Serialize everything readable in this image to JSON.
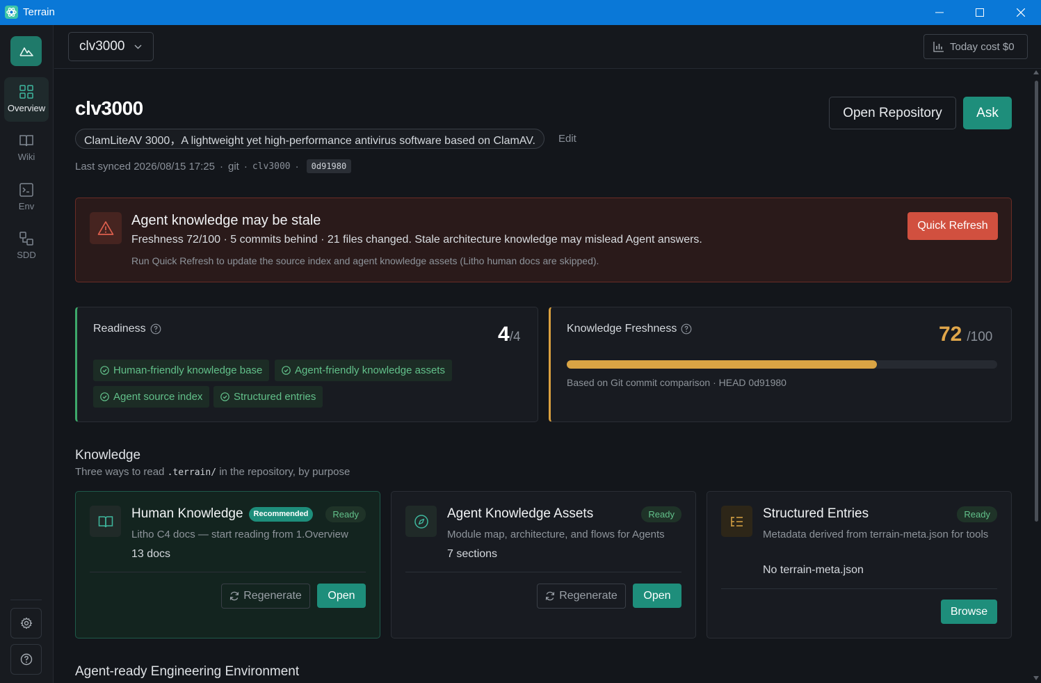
{
  "window": {
    "title": "Terrain"
  },
  "sidebar": {
    "items": [
      {
        "label": "Overview",
        "icon": "grid-icon"
      },
      {
        "label": "Wiki",
        "icon": "book-icon"
      },
      {
        "label": "Env",
        "icon": "terminal-icon"
      },
      {
        "label": "SDD",
        "icon": "shapes-icon"
      }
    ]
  },
  "topbar": {
    "repo": "clv3000",
    "cost": "Today cost $0"
  },
  "header": {
    "title": "clv3000",
    "description": "ClamLiteAV 3000，A lightweight yet high-performance antivirus software based on ClamAV.",
    "edit": "Edit",
    "synced": "Last synced 2026/08/15 17:25",
    "vcs": "git",
    "branch": "clv3000",
    "commit": "0d91980",
    "open_repo": "Open Repository",
    "ask": "Ask"
  },
  "alert": {
    "title": "Agent knowledge may be stale",
    "body": "Freshness 72/100 · 5 commits behind · 21 files changed. Stale architecture knowledge may mislead Agent answers.",
    "hint": "Run Quick Refresh to update the source index and agent knowledge assets (Litho human docs are skipped).",
    "action": "Quick Refresh",
    "color": "#d1503f"
  },
  "readiness": {
    "label": "Readiness",
    "value": "4",
    "total": "/4",
    "chips": [
      "Human-friendly knowledge base",
      "Agent-friendly knowledge assets",
      "Agent source index",
      "Structured entries"
    ]
  },
  "freshness": {
    "label": "Knowledge Freshness",
    "value": "72",
    "total": "/100",
    "progress": 0.72,
    "note": "Based on Git commit comparison · HEAD 0d91980",
    "color": "#d9a444"
  },
  "knowledge": {
    "title": "Knowledge",
    "subtitle_pre": "Three ways to read",
    "subtitle_code": ".terrain/",
    "subtitle_post": "in the repository, by purpose",
    "cards": [
      {
        "title": "Human Knowledge",
        "badge": "Recommended",
        "status": "Ready",
        "desc": "Litho C4 docs — start reading from 1.Overview",
        "count": "13 docs",
        "regen": "Regenerate",
        "open": "Open"
      },
      {
        "title": "Agent Knowledge Assets",
        "status": "Ready",
        "desc": "Module map, architecture, and flows for Agents",
        "count": "7 sections",
        "regen": "Regenerate",
        "open": "Open"
      },
      {
        "title": "Structured Entries",
        "status": "Ready",
        "desc": "Metadata derived from terrain-meta.json for tools",
        "count": "No terrain-meta.json",
        "browse": "Browse"
      }
    ]
  },
  "env_section": {
    "title": "Agent-ready Engineering Environment"
  },
  "colors": {
    "accent": "#1e8e7b",
    "titlebar": "#0a78d7",
    "ready": "#62c08a"
  }
}
